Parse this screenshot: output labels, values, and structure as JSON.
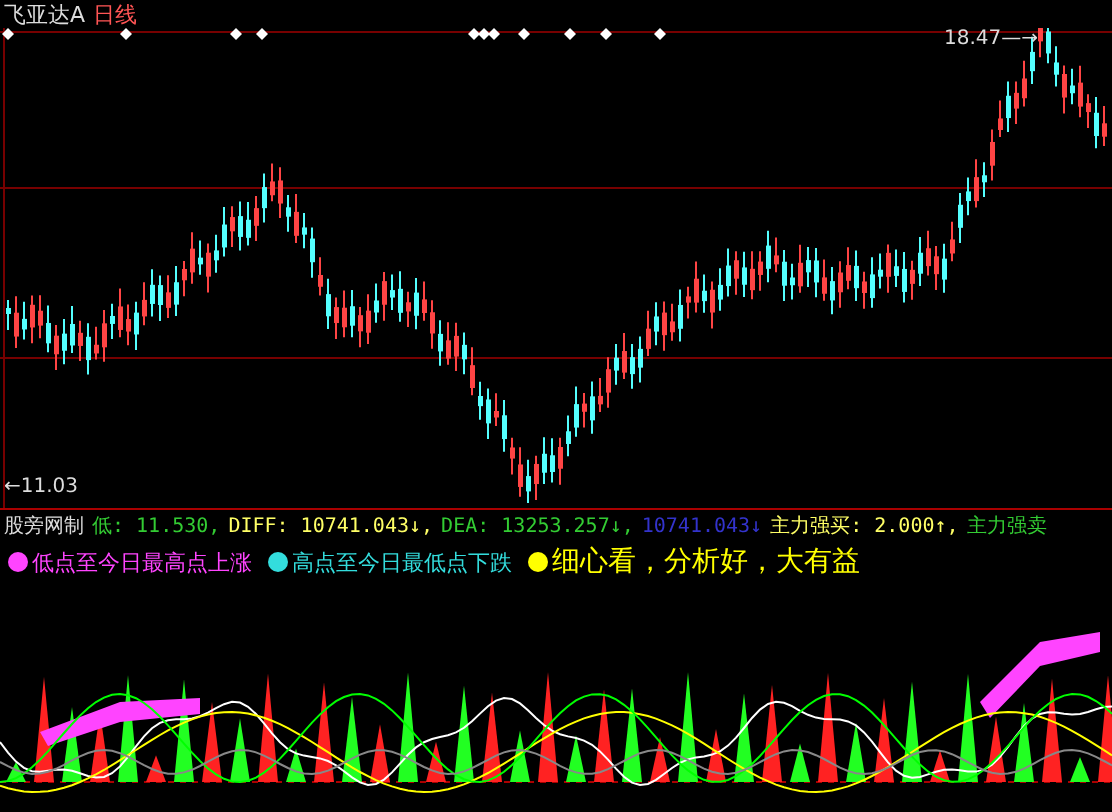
{
  "header": {
    "title": "飞亚达A",
    "period": "日线"
  },
  "price_chart": {
    "high_label": "18.47—→",
    "low_label": "←11.03"
  },
  "indicator_bar": {
    "name": "股旁网制",
    "items": [
      {
        "text": "低: 11.530,",
        "color": "#33cc33"
      },
      {
        "text": "DIFF: 10741.043↓,",
        "color": "#ffff66"
      },
      {
        "text": "DEA: 13253.257↓,",
        "color": "#33cc33"
      },
      {
        "text": "10741.043↓",
        "color": "#3333cc"
      },
      {
        "text": "主力强买: 2.000↑,",
        "color": "#ffff66"
      },
      {
        "text": "主力强卖",
        "color": "#33cc33"
      }
    ]
  },
  "legend": [
    {
      "text": "低点至今日最高点上涨",
      "color": "#ff44ff"
    },
    {
      "text": "高点至今日最低点下跌",
      "color": "#33dddd"
    },
    {
      "text": "细心看，分析好，大有益",
      "color": "#ffff00"
    }
  ]
}
